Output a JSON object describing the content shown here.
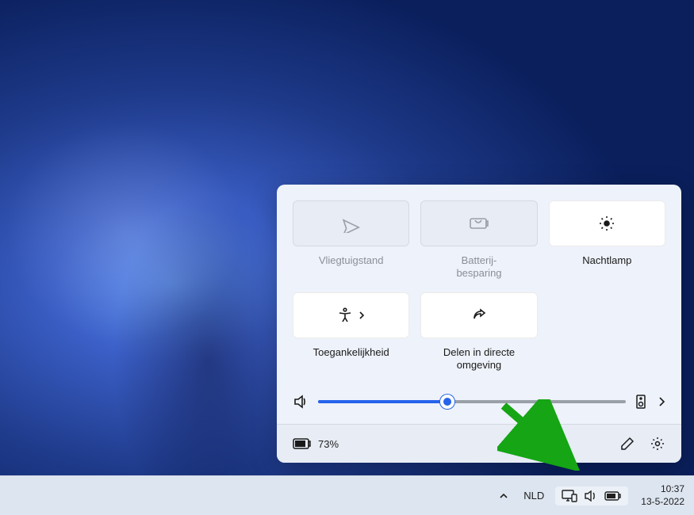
{
  "panel": {
    "tiles": [
      {
        "label": "Vliegtuigstand",
        "state": "disabled"
      },
      {
        "label": "Batterij-\nbesparing",
        "state": "disabled"
      },
      {
        "label": "Nachtlamp",
        "state": "enabled"
      },
      {
        "label": "Toegankelijkheid",
        "state": "enabled"
      },
      {
        "label": "Delen in directe omgeving",
        "state": "enabled"
      }
    ],
    "volume_percent": 42,
    "battery_text": "73%"
  },
  "taskbar": {
    "language": "NLD",
    "time": "10:37",
    "date": "13-5-2022"
  }
}
